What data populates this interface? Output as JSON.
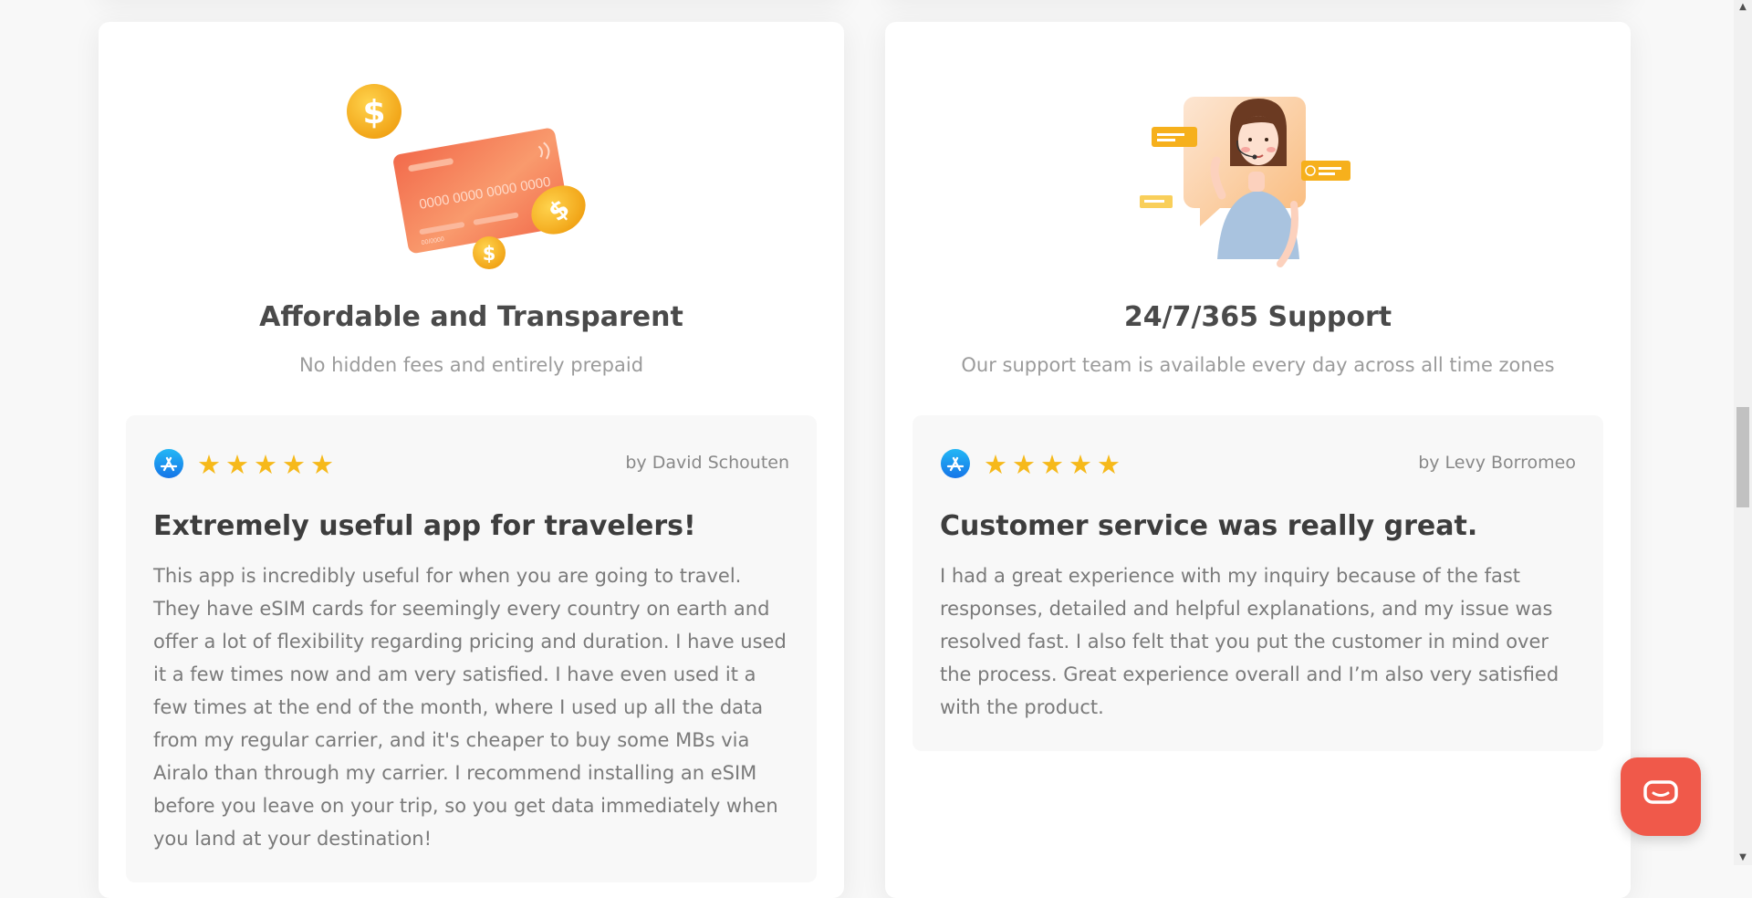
{
  "features": [
    {
      "title": "Affordable and Transparent",
      "subtitle": "No hidden fees and entirely prepaid",
      "illustration_icon": "credit-card-coins-illustration",
      "card_number": "0000 0000 0000 0000",
      "card_expiry": "00/0000",
      "review": {
        "store_icon": "app-store-icon",
        "rating": 5,
        "author": "by David Schouten",
        "title": "Extremely useful app for travelers!",
        "body": "This app is incredibly useful for when you are going to travel. They have eSIM cards for seemingly every country on earth and offer a lot of flexibility regarding pricing and duration. I have used it a few times now and am very satisfied. I have even used it a few times at the end of the month, where I used up all the data from my regular carrier, and it's cheaper to buy some MBs via Airalo than through my carrier. I recommend installing an eSIM before you leave on your trip, so you get data immediately when you land at your destination!"
      }
    },
    {
      "title": "24/7/365 Support",
      "subtitle": "Our support team is available every day across all time zones",
      "illustration_icon": "support-agent-illustration",
      "review": {
        "store_icon": "app-store-icon",
        "rating": 5,
        "author": "by Levy Borromeo",
        "title": "Customer service was really great.",
        "body": "I had a great experience with my inquiry because of the fast responses, detailed and helpful explanations, and my issue was resolved fast. I also felt that you put the customer in mind over the process. Great experience overall and I’m also very satisfied with the product."
      }
    }
  ],
  "colors": {
    "star": "#f6b91a",
    "chat_button": "#f0594a",
    "card_gradient_start": "#f26a4b",
    "coin": "#f5b21e"
  },
  "chat_widget": {
    "icon": "chat-bubble-icon"
  }
}
